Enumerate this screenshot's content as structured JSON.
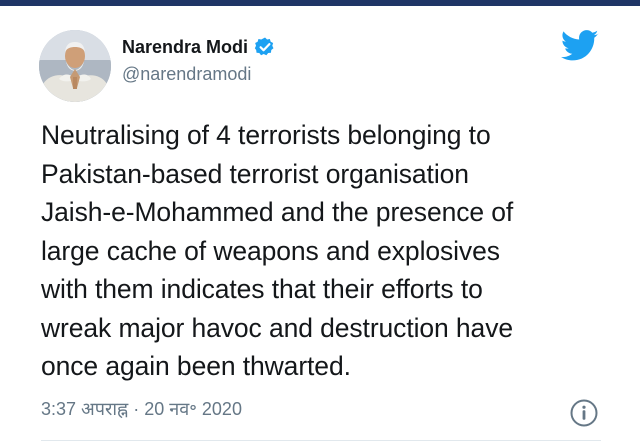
{
  "tweet": {
    "author": {
      "display_name": "Narendra Modi",
      "handle": "@narendramodi",
      "verified": true,
      "avatar_icon": "profile-photo"
    },
    "text_lines": [
      "Neutralising of 4 terrorists belonging to",
      "Pakistan-based terrorist organisation",
      "Jaish-e-Mohammed and the presence of",
      "large cache of weapons and explosives",
      "with them indicates that their efforts to",
      "wreak major havoc and destruction have",
      "once again been thwarted."
    ],
    "timestamp": "3:37 अपराह्न · 20 नव॰ 2020"
  },
  "icons": {
    "brand": "twitter-bird-icon",
    "verified": "verified-badge-icon",
    "info": "info-icon"
  },
  "colors": {
    "brand": "#1da1f2",
    "text": "#14171a",
    "secondary_text": "#657786",
    "top_bar": "#1f3566"
  }
}
